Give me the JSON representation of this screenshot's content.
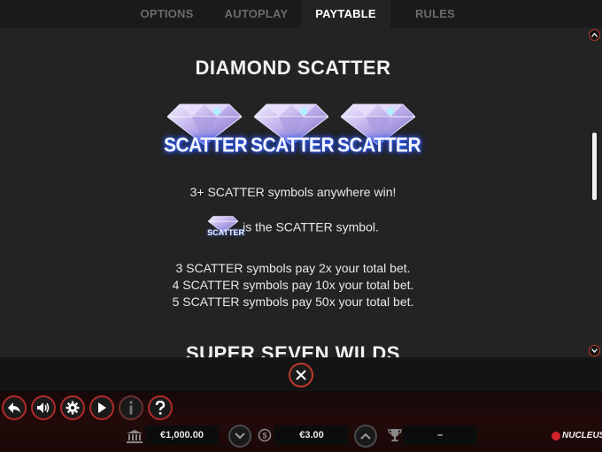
{
  "tabs": [
    {
      "label": "OPTIONS",
      "active": false
    },
    {
      "label": "AUTOPLAY",
      "active": false
    },
    {
      "label": "PAYTABLE",
      "active": true
    },
    {
      "label": "RULES",
      "active": false
    }
  ],
  "paytable": {
    "title": "DIAMOND SCATTER",
    "symbol_word": "SCATTER",
    "line_win": "3+ SCATTER symbols anywhere win!",
    "line_symbol": "is the SCATTER symbol.",
    "pays": [
      "3 SCATTER symbols pay 2x your total bet.",
      "4 SCATTER symbols pay 10x your total bet.",
      "5 SCATTER symbols pay 50x your total bet."
    ],
    "next_section_title": "SUPER SEVEN WILDS"
  },
  "bottom_bar": {
    "balance": "€1,000.00",
    "bet": "€3.00",
    "win": "–",
    "brand": "NUCLEUS"
  },
  "colors": {
    "accent_red": "#c0392b",
    "panel": "#232323",
    "active_tab_text": "#ffffff",
    "inactive_tab_text": "#6b6b6b"
  },
  "icons": [
    "back-icon",
    "sound-icon",
    "settings-gear-icon",
    "play-icon",
    "info-icon",
    "help-icon",
    "close-icon",
    "bank-icon",
    "coins-icon",
    "trophy-icon",
    "chevron-down-icon",
    "chevron-up-icon"
  ]
}
